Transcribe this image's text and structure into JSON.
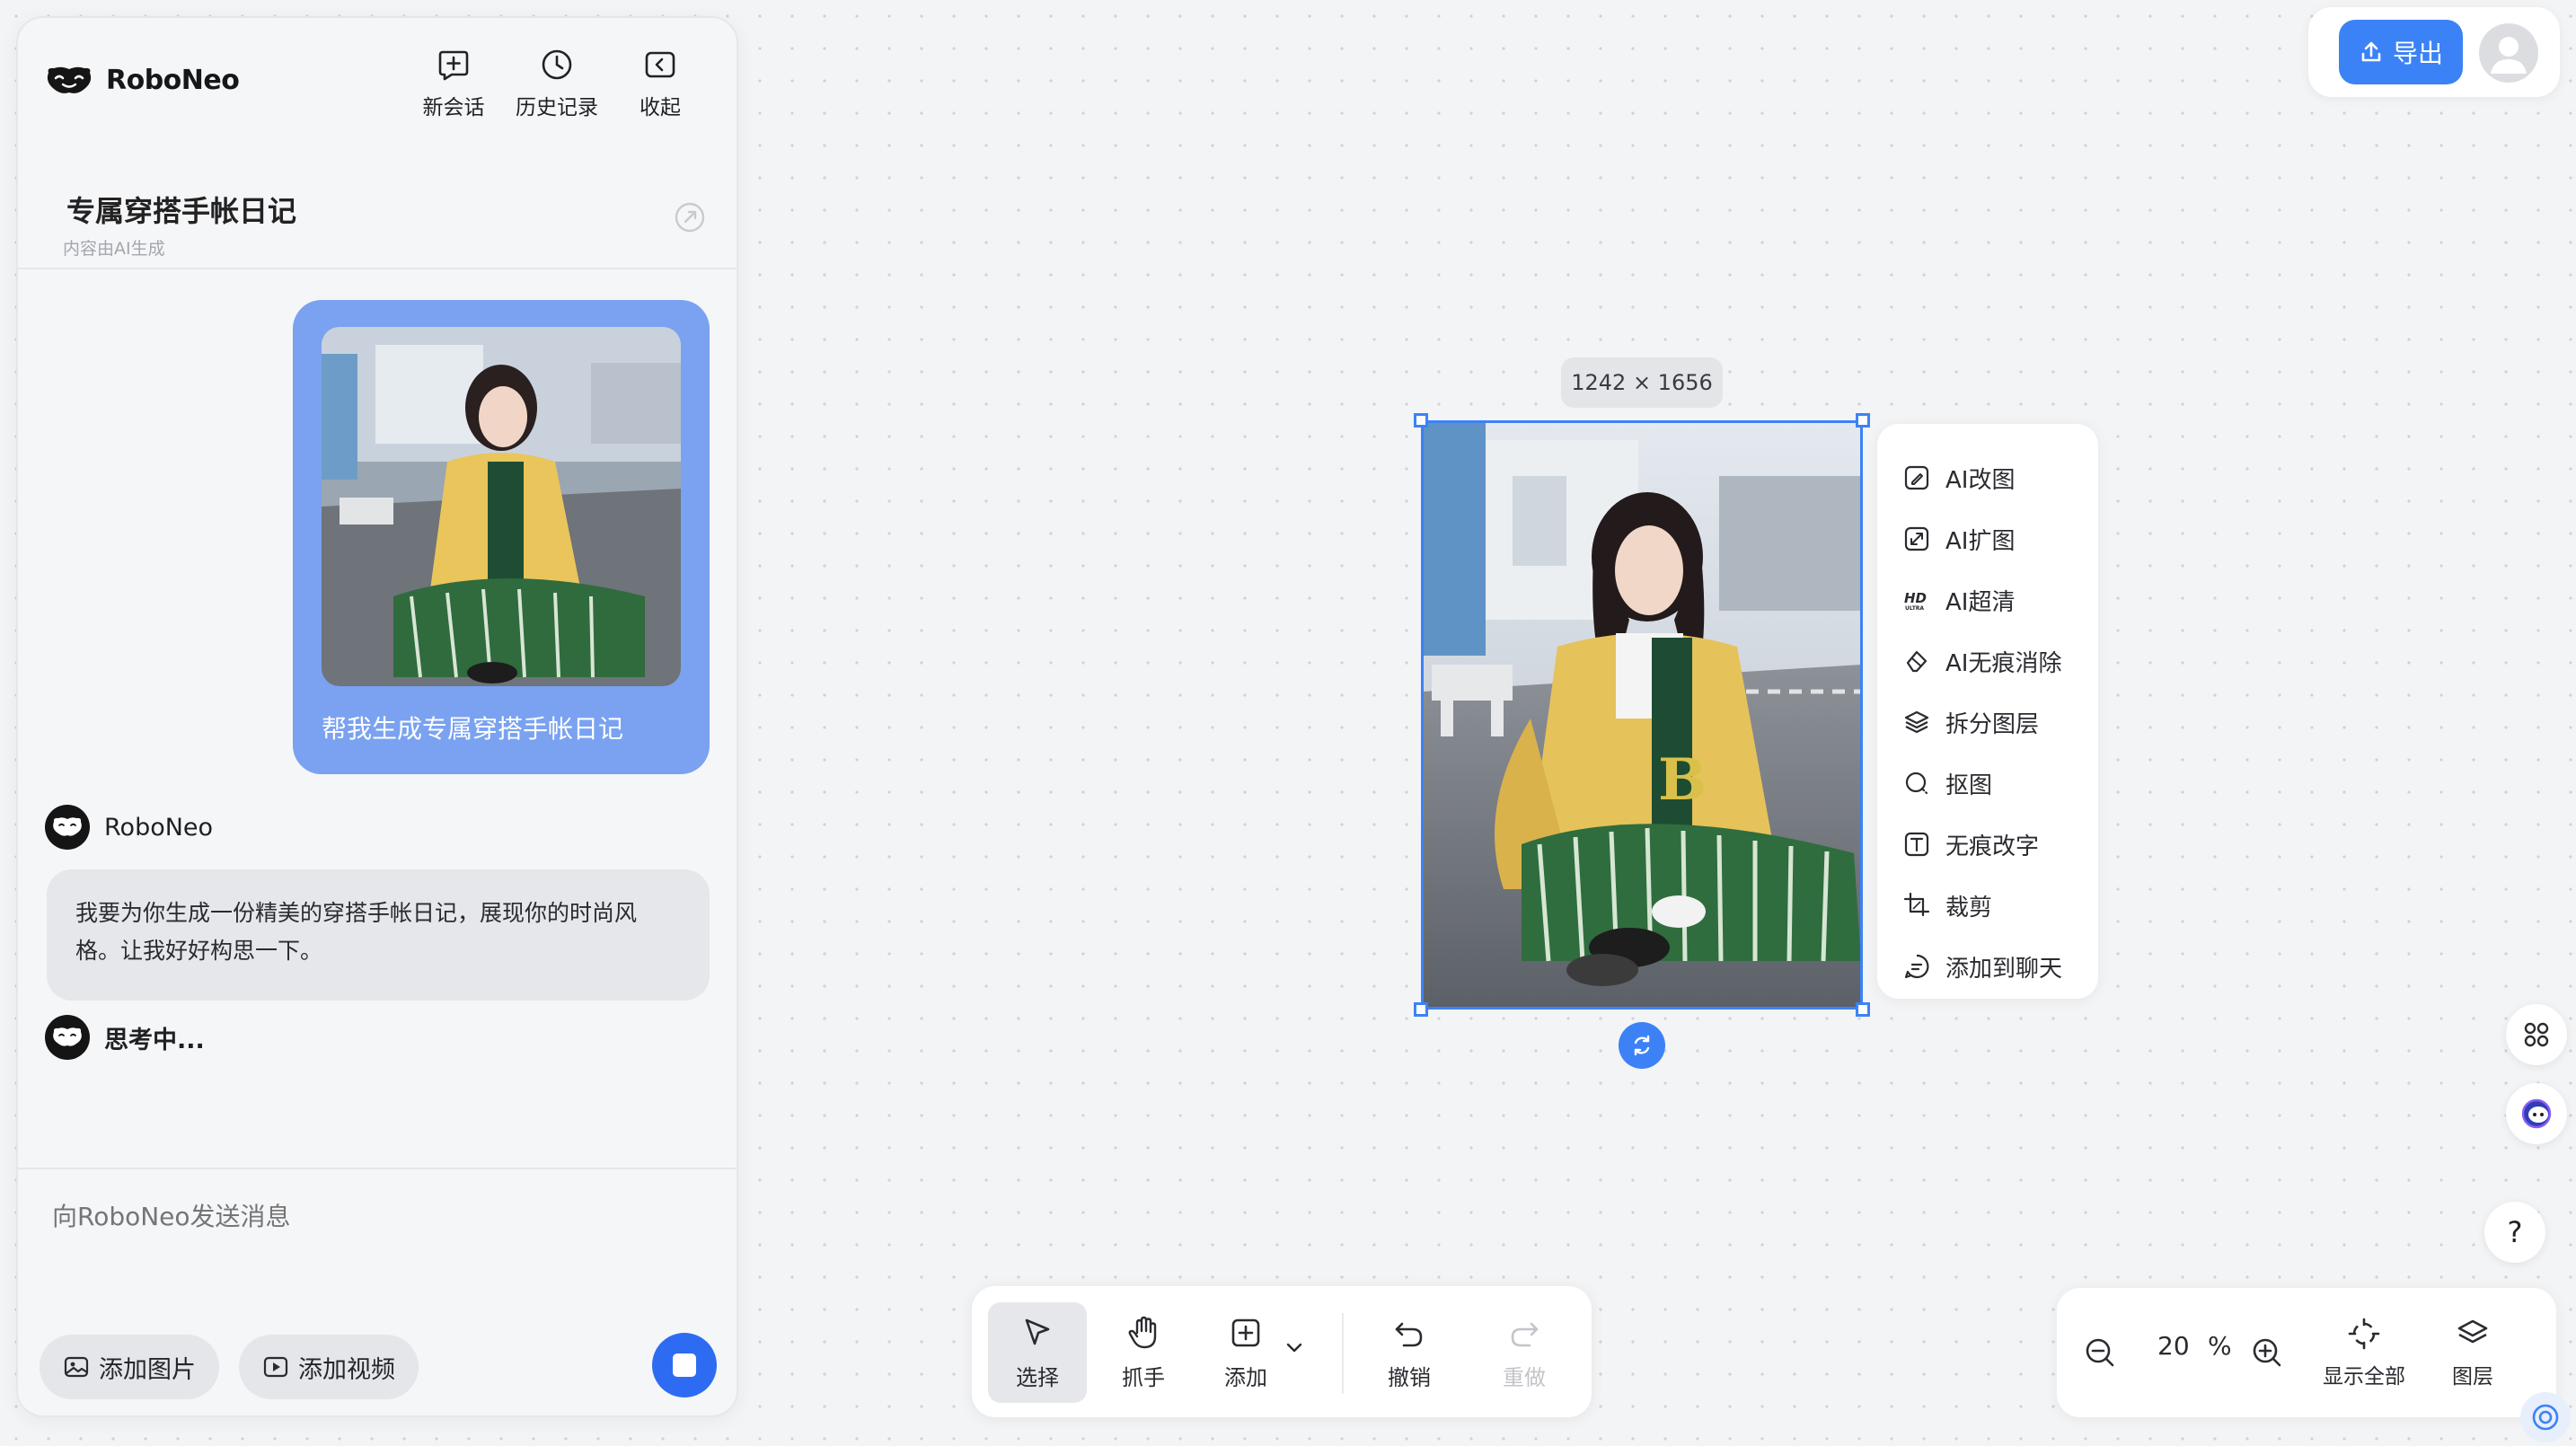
{
  "app": {
    "name": "RoboNeo"
  },
  "header": {
    "new_chat": "新会话",
    "history": "历史记录",
    "collapse": "收起"
  },
  "session": {
    "title": "专属穿搭手帐日记",
    "subtitle": "内容由AI生成"
  },
  "chat": {
    "user_message": "帮我生成专属穿搭手帐日记",
    "bot_name": "RoboNeo",
    "bot_message": "我要为你生成一份精美的穿搭手帐日记，展现你的时尚风格。让我好好构思一下。",
    "thinking": "思考中..."
  },
  "input": {
    "placeholder": "向RoboNeo发送消息",
    "add_image": "添加图片",
    "add_video": "添加视频"
  },
  "topbar": {
    "export": "导出"
  },
  "canvas": {
    "dimensions": "1242 × 1656"
  },
  "context_menu": [
    {
      "label": "AI改图",
      "icon": "ai-edit-icon"
    },
    {
      "label": "AI扩图",
      "icon": "ai-expand-icon"
    },
    {
      "label": "AI超清",
      "icon": "hd-ultra-icon"
    },
    {
      "label": "AI无痕消除",
      "icon": "eraser-icon"
    },
    {
      "label": "拆分图层",
      "icon": "layers-split-icon"
    },
    {
      "label": "抠图",
      "icon": "cutout-icon"
    },
    {
      "label": "无痕改字",
      "icon": "text-edit-icon"
    },
    {
      "label": "裁剪",
      "icon": "crop-icon"
    },
    {
      "label": "添加到聊天",
      "icon": "add-to-chat-icon"
    }
  ],
  "toolbar": {
    "select": "选择",
    "hand": "抓手",
    "add": "添加",
    "undo": "撤销",
    "redo": "重做"
  },
  "zoom": {
    "value": "20",
    "unit": "%",
    "fit_all": "显示全部",
    "layers": "图层"
  },
  "help": {
    "label": "?"
  },
  "colors": {
    "accent": "#3b82f6",
    "user_bubble": "#7aa2f1",
    "bot_bubble": "#e5e7ea"
  }
}
